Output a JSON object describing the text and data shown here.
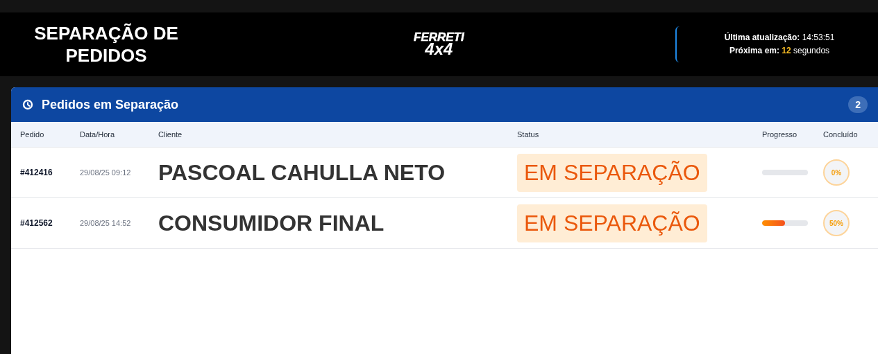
{
  "header": {
    "title": "SEPARAÇÃO DE PEDIDOS",
    "logo": {
      "line_1": "FERRETI",
      "line_2": "4x4"
    },
    "last_update": {
      "label": "Última atualização:",
      "value": "14:53:51"
    },
    "next_update": {
      "label": "Próxima em:",
      "count": "12",
      "unit": "segundos"
    }
  },
  "panel": {
    "title": "Pedidos em Separação",
    "count": "2",
    "columns": [
      "Pedido",
      "Data/Hora",
      "Cliente",
      "Status",
      "Progresso",
      "Concluído"
    ],
    "rows": [
      {
        "order": "#412416",
        "datetime": "29/08/25 09:12",
        "client": "PASCOAL CAHULLA NETO",
        "status": "EM SEPARAÇÃO",
        "level": 0,
        "done": "0%"
      },
      {
        "order": "#412562",
        "datetime": "29/08/25 14:52",
        "client": "CONSUMIDOR FINAL",
        "status": "EM SEPARAÇÃO",
        "level": 0.5,
        "done": "50%"
      }
    ]
  }
}
